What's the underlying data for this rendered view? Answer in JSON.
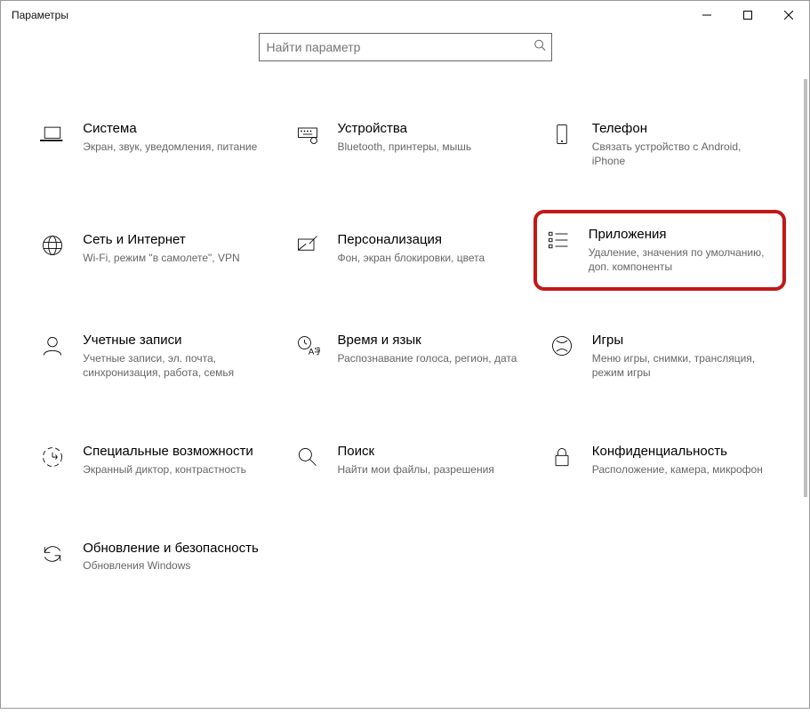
{
  "window": {
    "title": "Параметры"
  },
  "search": {
    "placeholder": "Найти параметр"
  },
  "categories": [
    {
      "id": "system",
      "title": "Система",
      "subtitle": "Экран, звук, уведомления, питание",
      "icon": "laptop-icon"
    },
    {
      "id": "devices",
      "title": "Устройства",
      "subtitle": "Bluetooth, принтеры, мышь",
      "icon": "keyboard-icon"
    },
    {
      "id": "phone",
      "title": "Телефон",
      "subtitle": "Связать устройство с Android, iPhone",
      "icon": "phone-icon"
    },
    {
      "id": "network",
      "title": "Сеть и Интернет",
      "subtitle": "Wi-Fi, режим \"в самолете\", VPN",
      "icon": "globe-icon"
    },
    {
      "id": "personalization",
      "title": "Персонализация",
      "subtitle": "Фон, экран блокировки, цвета",
      "icon": "personalize-icon"
    },
    {
      "id": "apps",
      "title": "Приложения",
      "subtitle": "Удаление, значения по умолчанию, доп. компоненты",
      "icon": "apps-icon",
      "highlighted": true
    },
    {
      "id": "accounts",
      "title": "Учетные записи",
      "subtitle": "Учетные записи, эл. почта, синхронизация, работа, семья",
      "icon": "person-icon"
    },
    {
      "id": "time",
      "title": "Время и язык",
      "subtitle": "Распознавание голоса, регион, дата",
      "icon": "time-language-icon"
    },
    {
      "id": "gaming",
      "title": "Игры",
      "subtitle": "Меню игры, снимки, трансляция, режим игры",
      "icon": "xbox-icon"
    },
    {
      "id": "ease",
      "title": "Специальные возможности",
      "subtitle": "Экранный диктор, контрастность",
      "icon": "ease-of-access-icon"
    },
    {
      "id": "search-cat",
      "title": "Поиск",
      "subtitle": "Найти мои файлы, разрешения",
      "icon": "search-category-icon"
    },
    {
      "id": "privacy",
      "title": "Конфиденциальность",
      "subtitle": "Расположение, камера, микрофон",
      "icon": "lock-icon"
    },
    {
      "id": "update",
      "title": "Обновление и безопасность",
      "subtitle": "Обновления Windows",
      "icon": "sync-icon"
    }
  ]
}
